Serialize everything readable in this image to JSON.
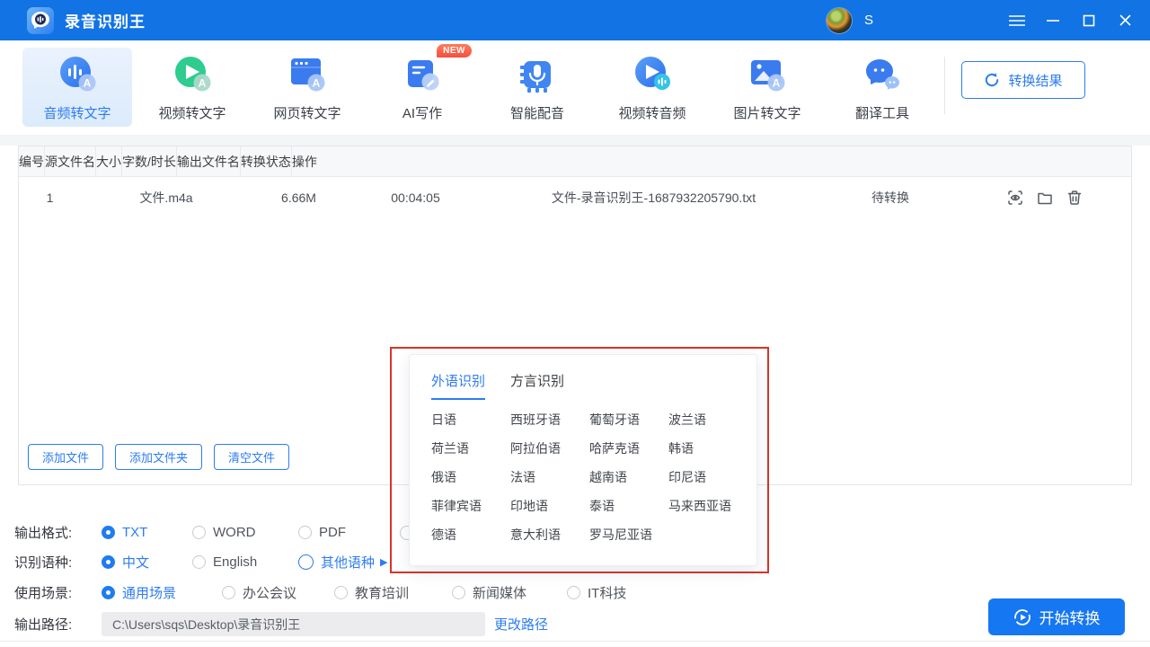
{
  "titlebar": {
    "app_name": "录音识别王",
    "user_name": "S"
  },
  "toolbar": {
    "items": [
      {
        "label": "音频转文字",
        "selected": true
      },
      {
        "label": "视频转文字"
      },
      {
        "label": "网页转文字"
      },
      {
        "label": "AI写作",
        "badge": "NEW"
      },
      {
        "label": "智能配音"
      },
      {
        "label": "视频转音频"
      },
      {
        "label": "图片转文字"
      },
      {
        "label": "翻译工具"
      }
    ],
    "results_button": "转换结果"
  },
  "table": {
    "headers": [
      "编号",
      "源文件名",
      "大小",
      "字数/时长",
      "输出文件名",
      "转换状态",
      "操作"
    ],
    "rows": [
      {
        "no": "1",
        "name": "文件.m4a",
        "size": "6.66M",
        "duration": "00:04:05",
        "output": "文件-录音识别王-1687932205790.txt",
        "status": "待转换"
      }
    ]
  },
  "file_actions": {
    "add_file": "添加文件",
    "add_folder": "添加文件夹",
    "clear_files": "清空文件"
  },
  "popup": {
    "tabs": [
      {
        "label": "外语识别",
        "active": true
      },
      {
        "label": "方言识别"
      }
    ],
    "languages": [
      "日语",
      "西班牙语",
      "葡萄牙语",
      "波兰语",
      "荷兰语",
      "阿拉伯语",
      "哈萨克语",
      "韩语",
      "俄语",
      "法语",
      "越南语",
      "印尼语",
      "菲律宾语",
      "印地语",
      "泰语",
      "马来西亚语",
      "德语",
      "意大利语",
      "罗马尼亚语"
    ]
  },
  "settings": {
    "output_format": {
      "label": "输出格式:",
      "options": [
        {
          "label": "TXT",
          "selected": true
        },
        {
          "label": "WORD"
        },
        {
          "label": "PDF"
        }
      ]
    },
    "language": {
      "label": "识别语种:",
      "options": [
        {
          "label": "中文",
          "selected": true
        },
        {
          "label": "English"
        },
        {
          "label": "其他语种",
          "highlight": true,
          "arrow": "▶"
        }
      ]
    },
    "scenario": {
      "label": "使用场景:",
      "options": [
        {
          "label": "通用场景",
          "selected": true
        },
        {
          "label": "办公会议"
        },
        {
          "label": "教育培训"
        },
        {
          "label": "新闻媒体"
        },
        {
          "label": "IT科技"
        }
      ]
    },
    "output_path": {
      "label": "输出路径:",
      "value": "C:\\Users\\sqs\\Desktop\\录音识别王",
      "change_link": "更改路径"
    }
  },
  "start_button": "开始转换",
  "colors": {
    "titlebar": "#1173e4",
    "accent": "#2d7cf0",
    "start_button": "#1677f2",
    "annotation": "#d8342a",
    "new_badge": "#f5503f"
  }
}
